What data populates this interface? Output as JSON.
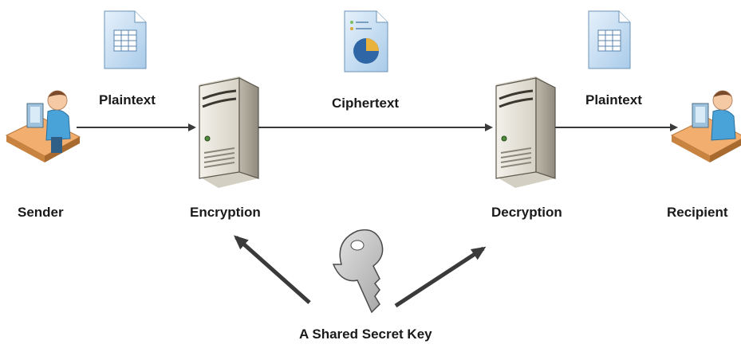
{
  "labels": {
    "sender": "Sender",
    "plaintext_left": "Plaintext",
    "encryption": "Encryption",
    "ciphertext": "Ciphertext",
    "decryption": "Decryption",
    "plaintext_right": "Plaintext",
    "recipient": "Recipient",
    "key": "A Shared Secret Key"
  },
  "icons": {
    "person": "person-at-desk-icon",
    "server": "server-tower-icon",
    "plaintext_doc": "spreadsheet-document-icon",
    "ciphertext_doc": "chart-document-icon",
    "key": "key-icon"
  },
  "colors": {
    "arrow": "#3a3a3a",
    "doc_fill": "#cfe3f4",
    "server_body": "#e9e6dc",
    "person_shirt": "#4aa3d8",
    "desk": "#f0a866"
  }
}
